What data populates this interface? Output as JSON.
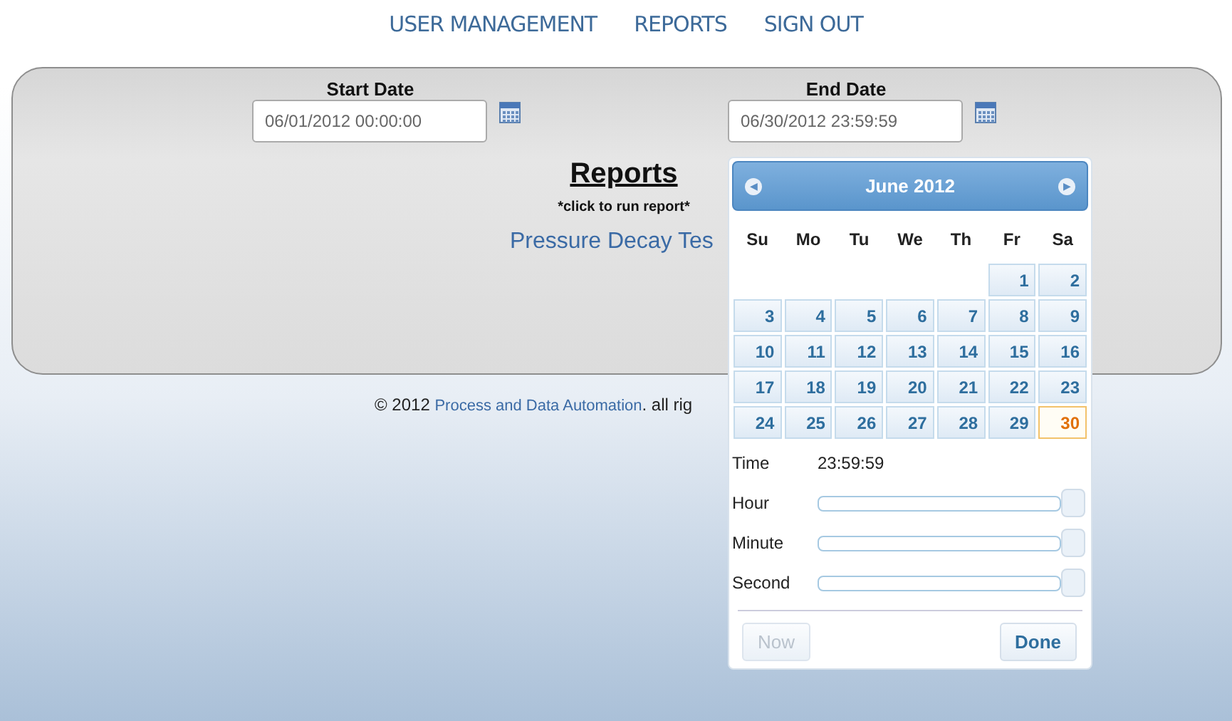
{
  "nav": [
    {
      "label": "USER MANAGEMENT"
    },
    {
      "label": "REPORTS"
    },
    {
      "label": "SIGN OUT"
    }
  ],
  "date_fields": [
    {
      "label": "Start Date",
      "value": "06/01/2012 00:00:00"
    },
    {
      "label": "End Date",
      "value": "06/30/2012 23:59:59"
    }
  ],
  "reports": {
    "title": "Reports",
    "hint": "*click to run report*",
    "links": [
      "Pressure Decay Tes"
    ]
  },
  "footer": {
    "prefix": "© 2012 ",
    "link": "Process and Data Automation",
    "suffix": ". all rig"
  },
  "datepicker": {
    "prev": "◀",
    "next": "▶",
    "month": "June 2012",
    "weekdays": [
      "Su",
      "Mo",
      "Tu",
      "We",
      "Th",
      "Fr",
      "Sa"
    ],
    "weeks": [
      [
        {
          "kind": "blank"
        },
        {
          "kind": "blank"
        },
        {
          "kind": "blank"
        },
        {
          "kind": "blank"
        },
        {
          "kind": "blank"
        },
        {
          "day": "1",
          "selected": false
        },
        {
          "day": "2",
          "selected": false
        }
      ],
      [
        {
          "day": "3",
          "selected": false
        },
        {
          "day": "4",
          "selected": false
        },
        {
          "day": "5",
          "selected": false
        },
        {
          "day": "6",
          "selected": false
        },
        {
          "day": "7",
          "selected": false
        },
        {
          "day": "8",
          "selected": false
        },
        {
          "day": "9",
          "selected": false
        }
      ],
      [
        {
          "day": "10",
          "selected": false
        },
        {
          "day": "11",
          "selected": false
        },
        {
          "day": "12",
          "selected": false
        },
        {
          "day": "13",
          "selected": false
        },
        {
          "day": "14",
          "selected": false
        },
        {
          "day": "15",
          "selected": false
        },
        {
          "day": "16",
          "selected": false
        }
      ],
      [
        {
          "day": "17",
          "selected": false
        },
        {
          "day": "18",
          "selected": false
        },
        {
          "day": "19",
          "selected": false
        },
        {
          "day": "20",
          "selected": false
        },
        {
          "day": "21",
          "selected": false
        },
        {
          "day": "22",
          "selected": false
        },
        {
          "day": "23",
          "selected": false
        }
      ],
      [
        {
          "day": "24",
          "selected": false
        },
        {
          "day": "25",
          "selected": false
        },
        {
          "day": "26",
          "selected": false
        },
        {
          "day": "27",
          "selected": false
        },
        {
          "day": "28",
          "selected": false
        },
        {
          "day": "29",
          "selected": false
        },
        {
          "day": "30",
          "selected": true
        }
      ]
    ],
    "time": {
      "label": "Time",
      "value": "23:59:59"
    },
    "sliders": [
      {
        "label": "Hour",
        "level": 1
      },
      {
        "label": "Minute",
        "level": 1
      },
      {
        "label": "Second",
        "level": 1
      }
    ],
    "buttons": [
      {
        "label": "Now",
        "disabled": true
      },
      {
        "label": "Done",
        "disabled": false
      }
    ]
  }
}
